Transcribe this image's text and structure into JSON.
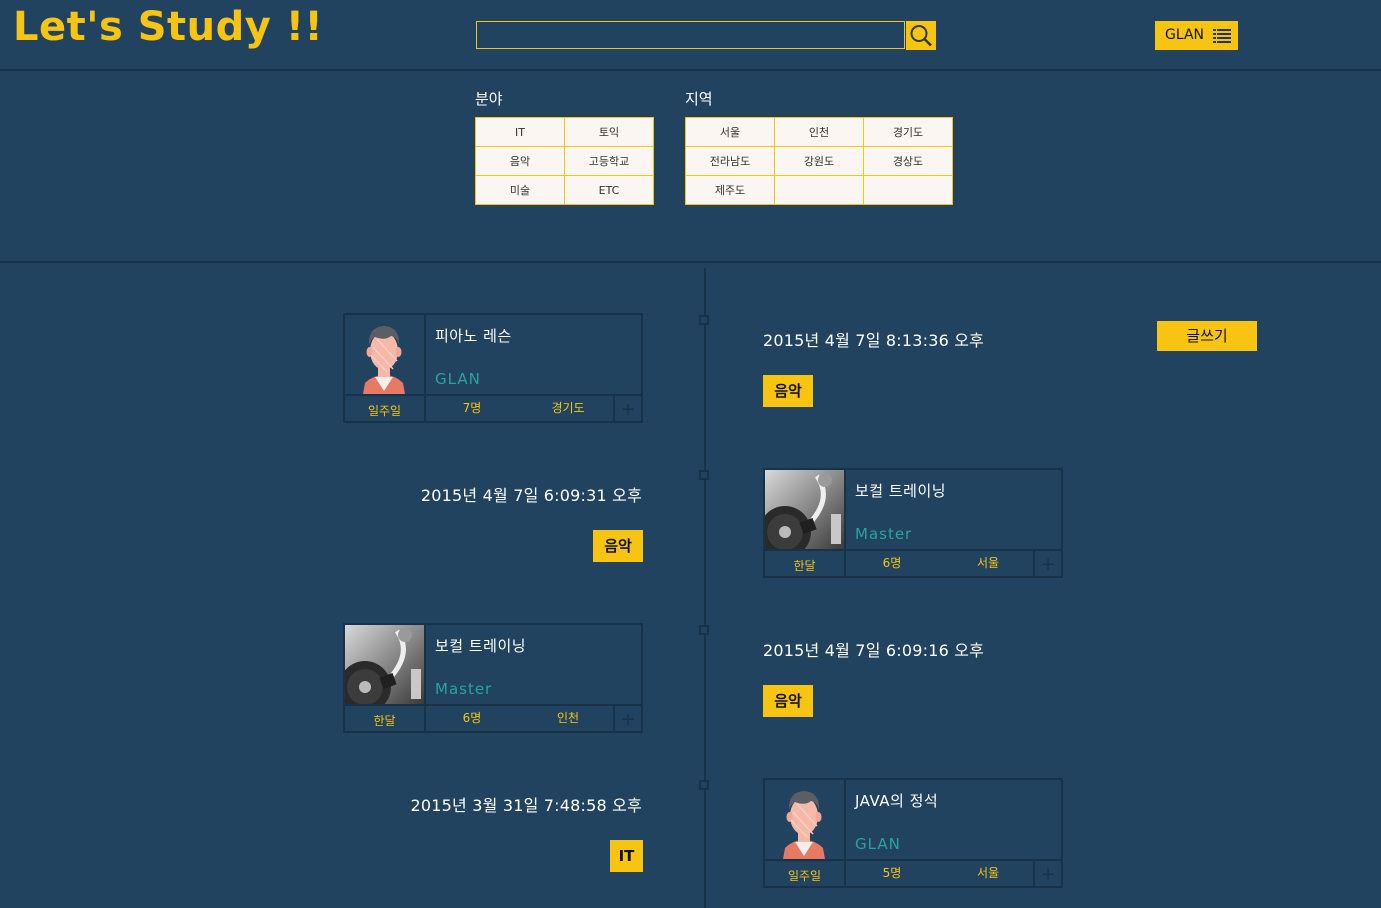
{
  "app": {
    "logo": "Let's Study !!"
  },
  "header": {
    "search_placeholder": "",
    "search_value": "",
    "user_label": "GLAN"
  },
  "filters": {
    "field": {
      "title": "분야",
      "rows": [
        [
          "IT",
          "토익"
        ],
        [
          "음악",
          "고등학교"
        ],
        [
          "미술",
          "ETC"
        ]
      ]
    },
    "region": {
      "title": "지역",
      "rows": [
        [
          "서울",
          "인천",
          "경기도"
        ],
        [
          "전라남도",
          "강원도",
          "경상도"
        ],
        [
          "제주도",
          "",
          ""
        ]
      ]
    }
  },
  "write_label": "글쓰기",
  "timeline": [
    {
      "side": "left",
      "card": {
        "title": "피아노 레슨",
        "author": "GLAN",
        "period": "일주일",
        "people": "7명",
        "region": "경기도",
        "thumb": "avatar"
      },
      "date": "2015년 4월 7일 8:13:36 오후",
      "tag": "음악"
    },
    {
      "side": "right",
      "card": {
        "title": "보컬 트레이닝",
        "author": "Master",
        "period": "한달",
        "people": "6명",
        "region": "서울",
        "thumb": "turntable"
      },
      "date": "2015년 4월 7일 6:09:31 오후",
      "tag": "음악"
    },
    {
      "side": "left",
      "card": {
        "title": "보컬 트레이닝",
        "author": "Master",
        "period": "한달",
        "people": "6명",
        "region": "인천",
        "thumb": "turntable"
      },
      "date": "2015년 4월 7일 6:09:16 오후",
      "tag": "음악"
    },
    {
      "side": "right",
      "card": {
        "title": "JAVA의 정석",
        "author": "GLAN",
        "period": "일주일",
        "people": "5명",
        "region": "서울",
        "thumb": "avatar"
      },
      "date": "2015년 3월 31일 7:48:58 오후",
      "tag": "IT"
    }
  ],
  "colors": {
    "background": "#21435f",
    "accent": "#f7c511",
    "line": "#183349",
    "author": "#2aa39b"
  }
}
